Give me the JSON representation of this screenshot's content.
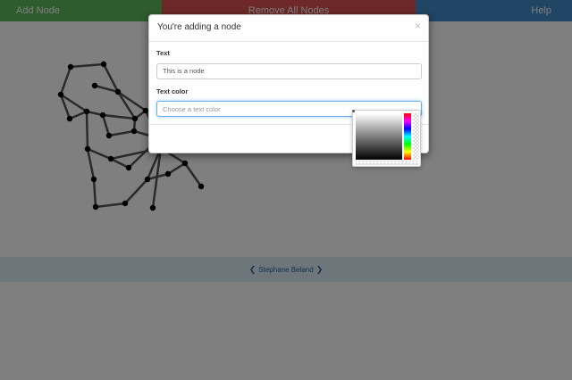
{
  "toolbar": {
    "add_label": "Add Node",
    "remove_label": "Remove All Nodes",
    "help_label": "Help"
  },
  "footer": {
    "author": "Stephane Beland",
    "prev_icon": "chevron-left-icon",
    "next_icon": "chevron-right-icon"
  },
  "modal": {
    "title": "You're adding a node",
    "close_icon": "close-icon",
    "text_label": "Text",
    "text_value": "This is a node",
    "color_label": "Text color",
    "color_placeholder": "Choose a text color"
  },
  "colors": {
    "add": "#5cb85c",
    "remove": "#d9534f",
    "help": "#428bca",
    "footer_bg": "#d9edf7",
    "node": "#000000",
    "edge": "#555555"
  }
}
